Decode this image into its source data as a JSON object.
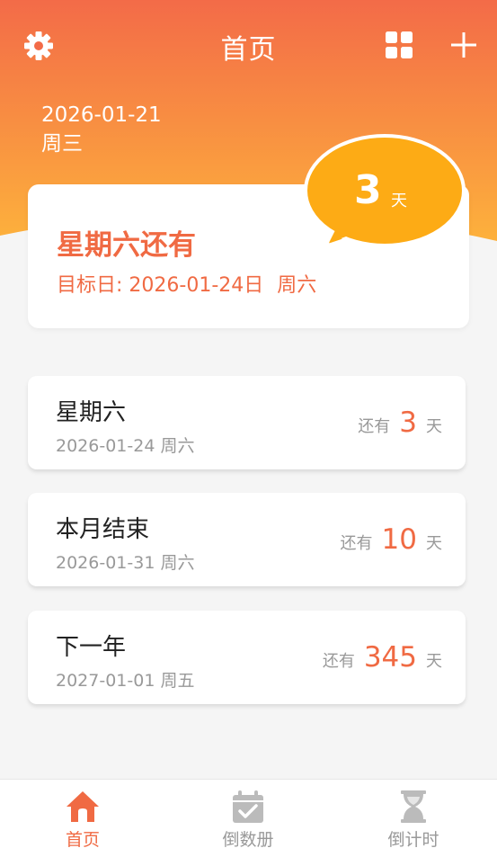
{
  "colors": {
    "accent": "#f06a43",
    "gradient_top": "#f36b48",
    "gradient_bottom": "#fdb13c",
    "bubble": "#fdab15",
    "inactive": "#999999"
  },
  "header": {
    "title": "首页",
    "left_icon": "gear-icon",
    "right_icons": [
      "grid-icon",
      "plus-icon"
    ]
  },
  "today": {
    "date": "2026-01-21",
    "weekday": "周三"
  },
  "featured": {
    "event_title": "星期六还有",
    "target_label": "目标日:",
    "target_date": "2026-01-24日",
    "target_weekday": "周六",
    "days": "3",
    "unit": "天"
  },
  "events": [
    {
      "name": "星期六",
      "date": "2026-01-24",
      "weekday": "周六",
      "prefix": "还有",
      "days": "3",
      "unit": "天"
    },
    {
      "name": "本月结束",
      "date": "2026-01-31",
      "weekday": "周六",
      "prefix": "还有",
      "days": "10",
      "unit": "天"
    },
    {
      "name": "下一年",
      "date": "2027-01-01",
      "weekday": "周五",
      "prefix": "还有",
      "days": "345",
      "unit": "天"
    }
  ],
  "tabbar": {
    "tabs": [
      {
        "label": "首页",
        "icon": "home-icon",
        "active": true
      },
      {
        "label": "倒数册",
        "icon": "calendar-check-icon",
        "active": false
      },
      {
        "label": "倒计时",
        "icon": "hourglass-icon",
        "active": false
      }
    ]
  }
}
